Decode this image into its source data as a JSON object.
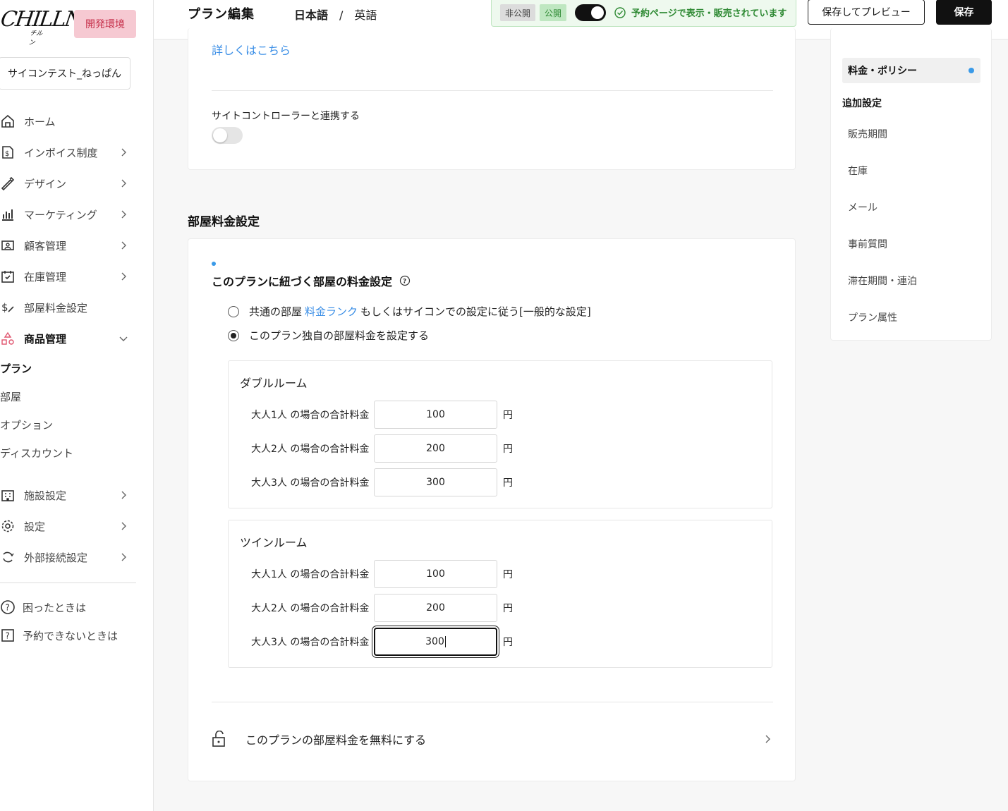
{
  "sidebar": {
    "logo": "CHILLNN",
    "logo_sub": "チルン",
    "env_badge": "開発環境",
    "store": "サイコンテスト_ねっぱん",
    "nav": [
      {
        "label": "ホーム"
      },
      {
        "label": "インボイス制度"
      },
      {
        "label": "デザイン"
      },
      {
        "label": "マーケティング"
      },
      {
        "label": "顧客管理"
      },
      {
        "label": "在庫管理"
      },
      {
        "label": "部屋料金設定"
      },
      {
        "label": "商品管理"
      }
    ],
    "sub": [
      {
        "label": "プラン"
      },
      {
        "label": "部屋"
      },
      {
        "label": "オプション"
      },
      {
        "label": "ディスカウント"
      }
    ],
    "nav2": [
      {
        "label": "施設設定"
      },
      {
        "label": "設定"
      },
      {
        "label": "外部接続設定"
      }
    ],
    "help": [
      {
        "label": "困ったときは"
      },
      {
        "label": "予約できないときは"
      }
    ]
  },
  "header": {
    "title": "プラン編集",
    "lang_ja": "日本語",
    "lang_sep": "/",
    "lang_en": "英語",
    "status_private": "非公開",
    "status_public": "公開",
    "status_message": "予約ページで表示・販売されています",
    "preview_button": "保存してプレビュー",
    "save_button": "保存"
  },
  "top_card": {
    "more_link": "詳しくはこちら",
    "site_controller_label": "サイトコントローラーと連携する"
  },
  "room_price": {
    "section_title": "部屋料金設定",
    "card_title": "このプランに紐づく部屋の料金設定",
    "option_common_prefix": "共通の部屋",
    "option_common_link": "料金ランク",
    "option_common_suffix": "もしくはサイコンでの設定に従う[一般的な設定]",
    "option_custom": "このプラン独自の部屋料金を設定する",
    "yen": "円",
    "rooms": [
      {
        "name": "ダブルルーム",
        "rows": [
          {
            "label": "大人1人 の場合の合計料金",
            "value": "100"
          },
          {
            "label": "大人2人 の場合の合計料金",
            "value": "200"
          },
          {
            "label": "大人3人 の場合の合計料金",
            "value": "300"
          }
        ]
      },
      {
        "name": "ツインルーム",
        "rows": [
          {
            "label": "大人1人 の場合の合計料金",
            "value": "100"
          },
          {
            "label": "大人2人 の場合の合計料金",
            "value": "200"
          },
          {
            "label": "大人3人 の場合の合計料金",
            "value": "300"
          }
        ]
      }
    ],
    "free_label": "このプランの部屋料金を無料にする"
  },
  "right_nav": {
    "active": "料金・ポリシー",
    "heading": "追加設定",
    "items": [
      "販売期間",
      "在庫",
      "メール",
      "事前質問",
      "滞在期間・連泊",
      "プラン属性"
    ]
  },
  "colors": {
    "accent_blue": "#3a8ee6",
    "dev_badge_bg": "#f6c9d2",
    "success_green": "#2f8a34"
  }
}
